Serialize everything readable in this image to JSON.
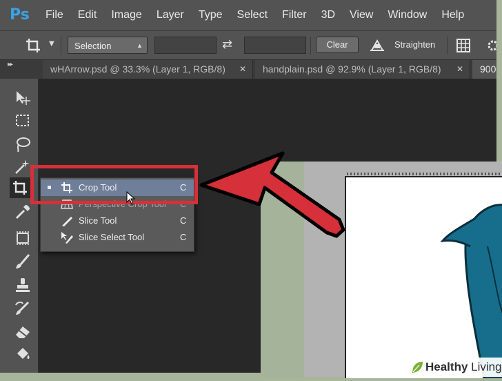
{
  "app": {
    "logo_text": "Ps"
  },
  "menu": [
    "File",
    "Edit",
    "Image",
    "Layer",
    "Type",
    "Select",
    "Filter",
    "3D",
    "View",
    "Window",
    "Help"
  ],
  "options_bar": {
    "ratio_select": "Selection",
    "clear_label": "Clear",
    "straighten_label": "Straighten"
  },
  "tabs": [
    {
      "label": "wHArrow.psd @ 33.3% (Layer 1, RGB/8)",
      "close": "✕"
    },
    {
      "label": "handplain.psd @ 92.9% (Layer 1, RGB/8)",
      "close": "✕"
    },
    {
      "label": "900",
      "close": ""
    }
  ],
  "flyout": [
    {
      "label": "Crop Tool",
      "key": "C",
      "selected": true
    },
    {
      "label": "Perspective Crop Tool",
      "key": "C",
      "selected": false
    },
    {
      "label": "Slice Tool",
      "key": "C",
      "selected": false
    },
    {
      "label": "Slice Select Tool",
      "key": "C",
      "selected": false
    }
  ],
  "watermark": {
    "prefix": "Healthy",
    "suffix": "Living"
  },
  "colors": {
    "accent_red": "#d6303a",
    "selection_blue": "#6f7f99",
    "ps_blue": "#3aa2e0",
    "panel_grey": "#535353"
  }
}
